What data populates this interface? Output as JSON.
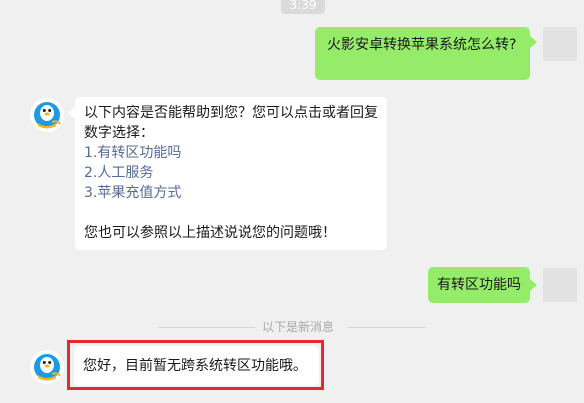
{
  "chat": {
    "timestamp": "3:39",
    "divider_label": "以下是新消息",
    "messages": [
      {
        "sender": "user",
        "text": "火影安卓转换苹果系统怎么转?"
      },
      {
        "sender": "service",
        "intro_line1": "以下内容是否能帮助到您？您可以点击或者回复",
        "intro_line2": "数字选择：",
        "options": [
          "1.有转区功能吗",
          "2.人工服务",
          "3.苹果充值方式"
        ],
        "footer": "您也可以参照以上描述说说您的问题哦！"
      },
      {
        "sender": "user",
        "text": "有转区功能吗"
      },
      {
        "sender": "service",
        "text": "您好，目前暂无跨系统转区功能哦。"
      }
    ]
  },
  "colors": {
    "user_bubble": "#95ec69",
    "service_bubble": "#ffffff",
    "background": "#f0f0f0",
    "option_link": "#576b95",
    "highlight_border": "#e8262e"
  },
  "icons": {
    "service_avatar": "qq-penguin-avatar-icon"
  }
}
